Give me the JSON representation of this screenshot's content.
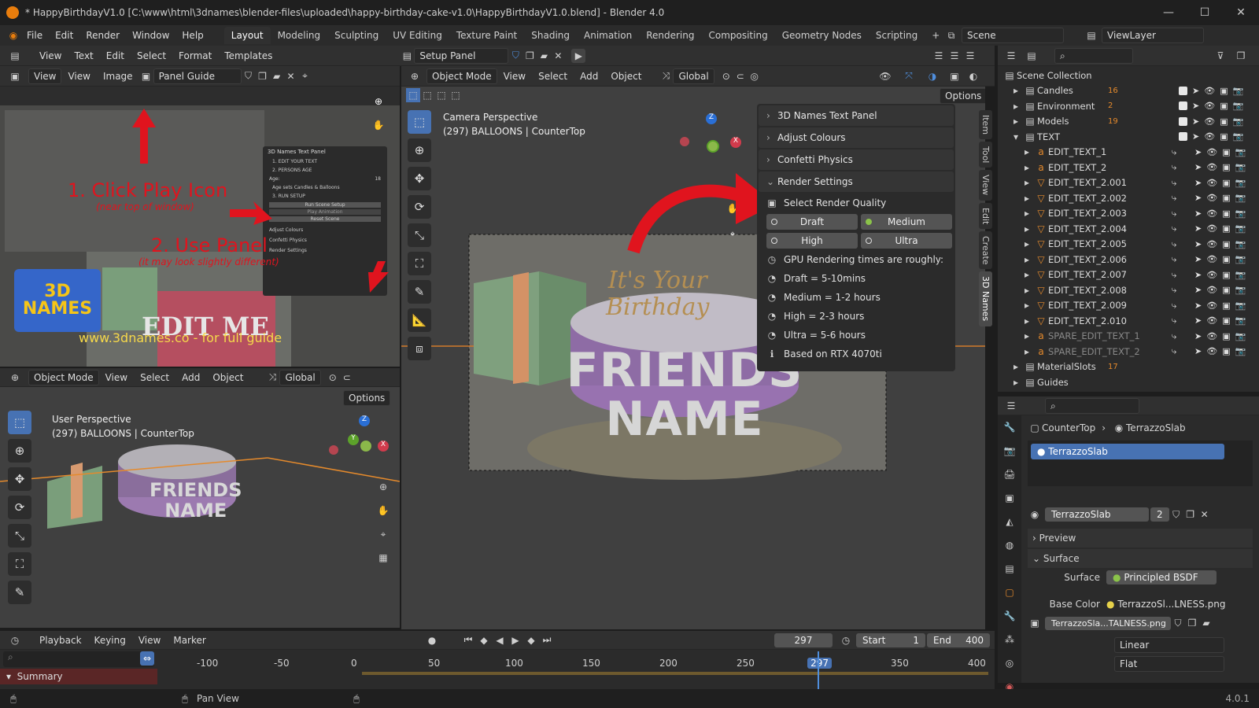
{
  "window": {
    "title": "* HappyBirthdayV1.0 [C:\\www\\html\\3dnames\\blender-files\\uploaded\\happy-birthday-cake-v1.0\\HappyBirthdayV1.0.blend] - Blender 4.0",
    "minimize": "—",
    "maximize": "☐",
    "close": "✕"
  },
  "menu": [
    "File",
    "Edit",
    "Render",
    "Window",
    "Help"
  ],
  "workspaces": [
    "Layout",
    "Modeling",
    "Sculpting",
    "UV Editing",
    "Texture Paint",
    "Shading",
    "Animation",
    "Rendering",
    "Compositing",
    "Geometry Nodes",
    "Scripting"
  ],
  "add_workspace": "+",
  "scene": {
    "name": "Scene",
    "view_layer": "ViewLayer"
  },
  "text_editor": {
    "menus": [
      "View",
      "Text",
      "Edit",
      "Select",
      "Format",
      "Templates"
    ],
    "file": "Setup Panel"
  },
  "image_editor": {
    "view": "View",
    "menus": [
      "View",
      "Image"
    ],
    "image": "Panel Guide"
  },
  "guide": {
    "step1": "1. Click Play Icon",
    "step1_sub": "(near top of window)",
    "step2": "2. Use Panel",
    "step2_sub": "(it may look slightly different)",
    "logo": "3D NAMES",
    "url": "www.3dnames.co - for full guide",
    "mini_panel_title": "3D Names Text Panel",
    "mini_items": [
      "1. EDIT YOUR TEXT",
      "2. PERSONS AGE",
      "Age:",
      "18",
      "Age sets Candles & Balloons",
      "3. RUN SETUP",
      "Run Scene Setup",
      "Play Animation",
      "Reset Scene",
      "Adjust Colours",
      "Confetti Physics",
      "Render Settings"
    ],
    "mini_edit": "EDIT ME"
  },
  "viewport_main": {
    "mode": "Object Mode",
    "menus": [
      "View",
      "Select",
      "Add",
      "Object"
    ],
    "transform": "Global",
    "options": "Options",
    "info1": "Camera Perspective",
    "info2": "(297) BALLOONS | CounterTop",
    "cake_text1": "It's Your",
    "cake_text2": "Birthday",
    "name1": "FRIENDS",
    "name2": "NAME",
    "axis_x": "X",
    "axis_z": "Z"
  },
  "viewport_small": {
    "mode": "Object Mode",
    "menus": [
      "View",
      "Select",
      "Add",
      "Object"
    ],
    "transform": "Global",
    "options": "Options",
    "info1": "User Perspective",
    "info2": "(297) BALLOONS | CounterTop",
    "axis_x": "X",
    "axis_y": "Y",
    "axis_z": "Z"
  },
  "npanel": {
    "sections": [
      "3D Names Text Panel",
      "Adjust Colours",
      "Confetti Physics"
    ],
    "render_title": "Render Settings",
    "select_quality": "Select Render Quality",
    "options": [
      {
        "label": "Draft",
        "on": false
      },
      {
        "label": "Medium",
        "on": true
      },
      {
        "label": "High",
        "on": false
      },
      {
        "label": "Ultra",
        "on": false
      }
    ],
    "gpu_label": "GPU Rendering times are roughly:",
    "times": [
      "Draft = 5-10mins",
      "Medium = 1-2 hours",
      "High = 2-3 hours",
      "Ultra = 5-6 hours",
      "Based on RTX 4070ti"
    ]
  },
  "side_tabs": [
    "Item",
    "Tool",
    "View",
    "Edit",
    "Create",
    "3D Names"
  ],
  "outliner": {
    "root": "Scene Collection",
    "collections": [
      {
        "name": "Candles",
        "badge": "16"
      },
      {
        "name": "Environment",
        "badge": "2"
      },
      {
        "name": "Models",
        "badge": "19"
      },
      {
        "name": "TEXT",
        "badge": ""
      }
    ],
    "items": [
      "EDIT_TEXT_1",
      "EDIT_TEXT_2",
      "EDIT_TEXT_2.001",
      "EDIT_TEXT_2.002",
      "EDIT_TEXT_2.003",
      "EDIT_TEXT_2.004",
      "EDIT_TEXT_2.005",
      "EDIT_TEXT_2.006",
      "EDIT_TEXT_2.007",
      "EDIT_TEXT_2.008",
      "EDIT_TEXT_2.009",
      "EDIT_TEXT_2.010",
      "SPARE_EDIT_TEXT_1",
      "SPARE_EDIT_TEXT_2"
    ],
    "more": [
      {
        "name": "MaterialSlots",
        "badge": "17"
      },
      {
        "name": "Guides",
        "badge": ""
      }
    ]
  },
  "properties": {
    "object": "CounterTop",
    "material": "TerrazzoSlab",
    "slot": "TerrazzoSlab",
    "mat_name": "TerrazzoSlab",
    "users": "2",
    "preview": "Preview",
    "surface": "Surface",
    "surface_label": "Surface",
    "surface_val": "Principled BSDF",
    "base_color_label": "Base Color",
    "base_color_val": "TerrazzoSl...LNESS.png",
    "image": "TerrazzoSla...TALNESS.png",
    "interp": "Linear",
    "proj": "Flat"
  },
  "timeline": {
    "menus": [
      "Playback",
      "Keying",
      "View",
      "Marker"
    ],
    "frame": "297",
    "start_label": "Start",
    "start": "1",
    "end_label": "End",
    "end": "400",
    "ticks": [
      "-100",
      "-50",
      "0",
      "50",
      "100",
      "150",
      "200",
      "250",
      "297",
      "350",
      "400"
    ]
  },
  "search": {
    "placeholder": ""
  },
  "summary": "Summary",
  "status": {
    "pan": "Pan View",
    "version": "4.0.1"
  }
}
